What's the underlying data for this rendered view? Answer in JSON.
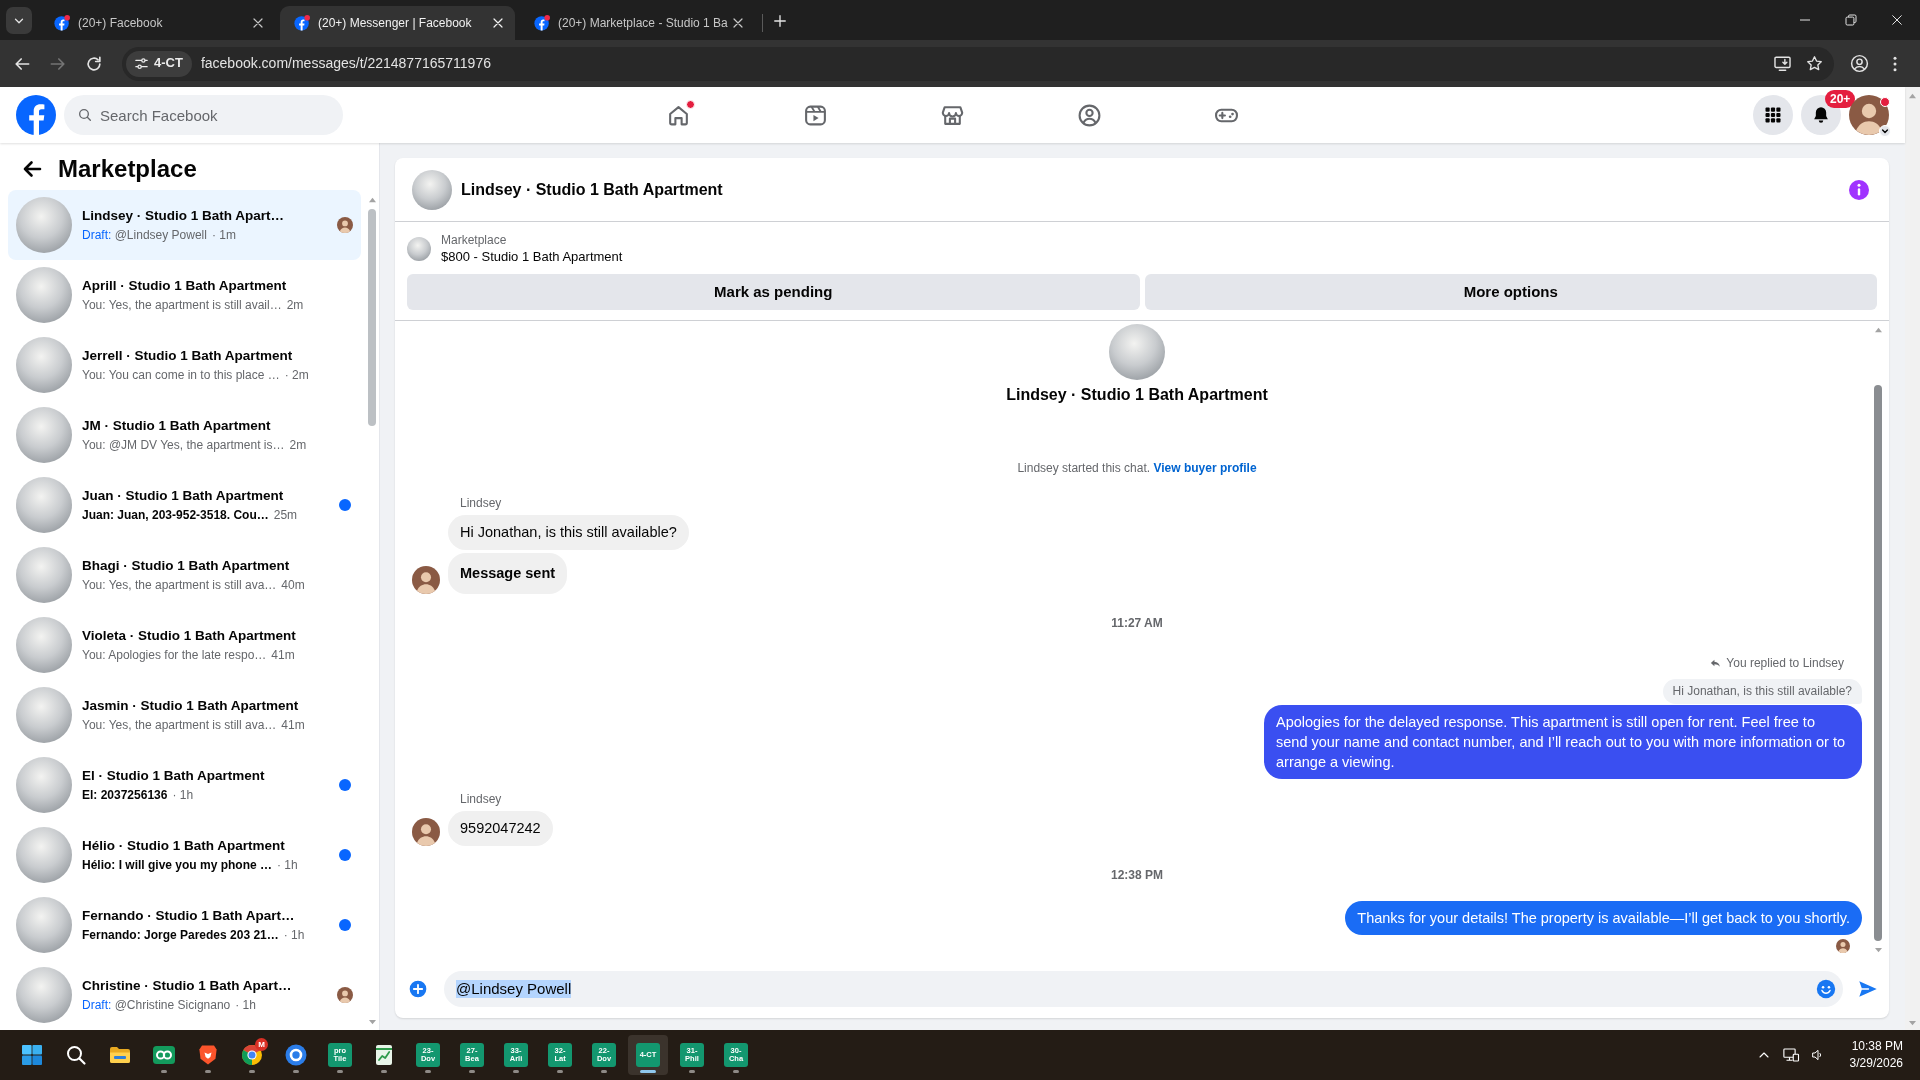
{
  "browser": {
    "tabs": [
      {
        "title": "(20+) Facebook",
        "selected": false
      },
      {
        "title": "(20+) Messenger | Facebook",
        "selected": true
      },
      {
        "title": "(20+) Marketplace - Studio 1 Ba",
        "selected": false
      }
    ],
    "forward_enabled": false,
    "site_chip": "4-CT",
    "url": "facebook.com/messages/t/2214877165711976"
  },
  "header": {
    "search_placeholder": "Search Facebook",
    "nav": [
      {
        "kind": "home",
        "dot": true
      },
      {
        "kind": "video",
        "dot": false
      },
      {
        "kind": "marketplace",
        "dot": false
      },
      {
        "kind": "groups",
        "dot": false
      },
      {
        "kind": "gaming",
        "dot": false
      }
    ],
    "notification_count": "20+"
  },
  "sidebar": {
    "title": "Marketplace",
    "items": [
      {
        "title": "Lindsey · Studio 1 Bath Apart…",
        "draft": "Draft:",
        "preview": "@Lindsey Powell",
        "time": "· 1m",
        "unread": false,
        "seen": true,
        "selected": true
      },
      {
        "title": "Aprill · Studio 1 Bath Apartment",
        "preview": "You: Yes, the apartment is still avail…",
        "time": "2m",
        "unread": false,
        "seen": false,
        "selected": false
      },
      {
        "title": "Jerrell · Studio 1 Bath Apartment",
        "preview": "You: You can come in to this place …",
        "time": "· 2m",
        "unread": false,
        "seen": false,
        "selected": false
      },
      {
        "title": "JM · Studio 1 Bath Apartment",
        "preview": "You: @JM DV Yes, the apartment is…",
        "time": "2m",
        "unread": false,
        "seen": false,
        "selected": false
      },
      {
        "title": "Juan · Studio 1 Bath Apartment",
        "preview": "Juan: Juan, 203-952-3518. Cou…",
        "time": "25m",
        "unread": true,
        "seen": false,
        "selected": false
      },
      {
        "title": "Bhagi · Studio 1 Bath Apartment",
        "preview": "You: Yes, the apartment is still ava…",
        "time": "40m",
        "unread": false,
        "seen": false,
        "selected": false
      },
      {
        "title": "Violeta · Studio 1 Bath Apartment",
        "preview": "You: Apologies for the late respo…",
        "time": "41m",
        "unread": false,
        "seen": false,
        "selected": false
      },
      {
        "title": "Jasmin · Studio 1 Bath Apartment",
        "preview": "You: Yes, the apartment is still ava…",
        "time": "41m",
        "unread": false,
        "seen": false,
        "selected": false
      },
      {
        "title": "El · Studio 1 Bath Apartment",
        "preview": "El: 2037256136",
        "time": "· 1h",
        "unread": true,
        "seen": false,
        "selected": false
      },
      {
        "title": "Hélio · Studio 1 Bath Apartment",
        "preview": "Hélio: I will give you my phone …",
        "time": "· 1h",
        "unread": true,
        "seen": false,
        "selected": false
      },
      {
        "title": "Fernando · Studio 1 Bath Apart…",
        "preview": "Fernando: Jorge Paredes 203 21…",
        "time": "· 1h",
        "unread": true,
        "seen": false,
        "selected": false
      },
      {
        "title": "Christine · Studio 1 Bath Apart…",
        "draft": "Draft:",
        "preview": "@Christine Sicignano",
        "time": "· 1h",
        "unread": false,
        "seen": true,
        "selected": false
      }
    ]
  },
  "chat": {
    "title": "Lindsey · Studio 1 Bath Apartment",
    "listing_label": "Marketplace",
    "listing_title": "$800 - Studio 1 Bath Apartment",
    "actions": [
      "Mark as pending",
      "More options"
    ],
    "intro_title": "Lindsey · Studio 1 Bath Apartment",
    "intro_note": "Lindsey started this chat.",
    "intro_link": "View buyer profile",
    "messages": [
      {
        "kind": "sender",
        "text": "Lindsey"
      },
      {
        "kind": "incoming",
        "text": "Hi Jonathan, is this still available?",
        "avatar": false
      },
      {
        "kind": "notice",
        "text": "Message sent",
        "avatar": true
      },
      {
        "kind": "time",
        "text": "11:27 AM"
      },
      {
        "kind": "reply_note",
        "text": "You replied to Lindsey"
      },
      {
        "kind": "quote",
        "text": "Hi Jonathan, is this still available?"
      },
      {
        "kind": "outgoing",
        "text": "Apologies for the delayed response. This apartment is still open for rent. Feel free to send your name and contact number, and I’ll reach out to you with more information or to arrange a viewing.",
        "seen": false
      },
      {
        "kind": "sender",
        "text": "Lindsey"
      },
      {
        "kind": "incoming",
        "text": "9592047242",
        "avatar": true
      },
      {
        "kind": "time",
        "text": "12:38 PM"
      },
      {
        "kind": "outgoing",
        "text": "Thanks for your details! The property is available—I’ll get back to you shortly.",
        "seen": true
      }
    ],
    "composer": {
      "value": "@Lindsey Powell",
      "text_selected": true
    }
  },
  "taskbar": {
    "apps": [
      {
        "kind": "start",
        "running": false,
        "selected": false
      },
      {
        "kind": "search",
        "running": false,
        "selected": false
      },
      {
        "kind": "folder",
        "running": false,
        "selected": false
      },
      {
        "kind": "rings",
        "running": true,
        "selected": false
      },
      {
        "kind": "shield",
        "running": true,
        "selected": false
      },
      {
        "kind": "browser",
        "badge": "M",
        "running": true,
        "selected": false
      },
      {
        "kind": "ring",
        "running": true,
        "selected": false
      },
      {
        "kind": "tile",
        "label": "pro Tile",
        "running": true,
        "selected": false
      },
      {
        "kind": "chart",
        "running": true,
        "selected": false
      },
      {
        "kind": "tile",
        "label": "23-Dov",
        "running": true,
        "selected": false
      },
      {
        "kind": "tile",
        "label": "27-Bea",
        "running": true,
        "selected": false
      },
      {
        "kind": "tile",
        "label": "33-Arli",
        "running": true,
        "selected": false
      },
      {
        "kind": "tile",
        "label": "32-Lat",
        "running": true,
        "selected": false
      },
      {
        "kind": "tile",
        "label": "22-Dov",
        "running": true,
        "selected": false
      },
      {
        "kind": "tile",
        "label": "4-CT",
        "running": true,
        "selected": true
      },
      {
        "kind": "tile",
        "label": "31-Phil",
        "running": true,
        "selected": false
      },
      {
        "kind": "tile",
        "label": "30-Cha",
        "running": true,
        "selected": false
      }
    ],
    "time": "10:38 PM",
    "date": "3/29/2026"
  }
}
